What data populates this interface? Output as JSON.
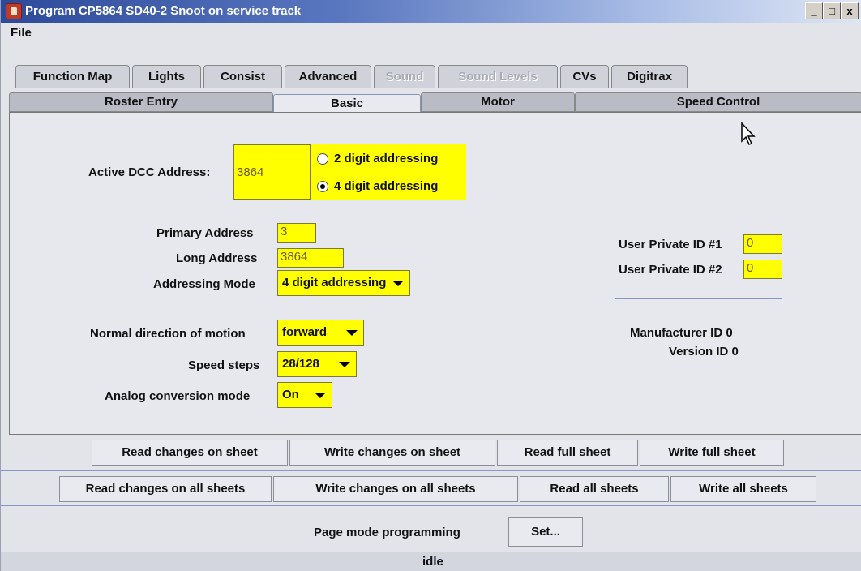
{
  "window": {
    "title": "Program CP5864 SD40-2 Snoot on service track",
    "minimize": "_",
    "maximize": "□",
    "close": "x"
  },
  "menu": {
    "file": "File"
  },
  "tabs_top": [
    {
      "label": "Function Map",
      "enabled": true
    },
    {
      "label": "Lights",
      "enabled": true
    },
    {
      "label": "Consist",
      "enabled": true
    },
    {
      "label": "Advanced",
      "enabled": true
    },
    {
      "label": "Sound",
      "enabled": false
    },
    {
      "label": "Sound Levels",
      "enabled": false
    },
    {
      "label": "CVs",
      "enabled": true
    },
    {
      "label": "Digitrax",
      "enabled": true
    }
  ],
  "tabs_bottom": [
    {
      "label": "Roster Entry"
    },
    {
      "label": "Basic",
      "selected": true
    },
    {
      "label": "Motor"
    },
    {
      "label": "Speed Control"
    }
  ],
  "basic": {
    "active_dcc_label": "Active DCC Address:",
    "active_dcc_value": "3864",
    "radio_2digit": "2 digit addressing",
    "radio_4digit": "4 digit addressing",
    "selected_radio": "4 digit addressing",
    "primary_address_label": "Primary Address",
    "primary_address_value": "3",
    "long_address_label": "Long Address",
    "long_address_value": "3864",
    "addressing_mode_label": "Addressing Mode",
    "addressing_mode_value": "4 digit addressing",
    "direction_label": "Normal direction of motion",
    "direction_value": "forward",
    "speed_steps_label": "Speed steps",
    "speed_steps_value": "28/128",
    "analog_label": "Analog conversion mode",
    "analog_value": "On",
    "user_id1_label": "User Private ID #1",
    "user_id1_value": "0",
    "user_id2_label": "User Private ID #2",
    "user_id2_value": "0",
    "manufacturer_id": "Manufacturer ID 0",
    "version_id": "Version ID 0"
  },
  "sheet_buttons": {
    "read_changes": "Read changes on sheet",
    "write_changes": "Write changes on sheet",
    "read_full": "Read full sheet",
    "write_full": "Write full sheet"
  },
  "all_buttons": {
    "read_changes_all": "Read changes on all sheets",
    "write_changes_all": "Write changes on all sheets",
    "read_all": "Read all sheets",
    "write_all": "Write all sheets"
  },
  "programming": {
    "mode_label": "Page mode programming",
    "set_button": "Set..."
  },
  "status": "idle",
  "colors": {
    "field_bg": "#ffff00",
    "title_gradient_start": "#2c4a9a"
  }
}
